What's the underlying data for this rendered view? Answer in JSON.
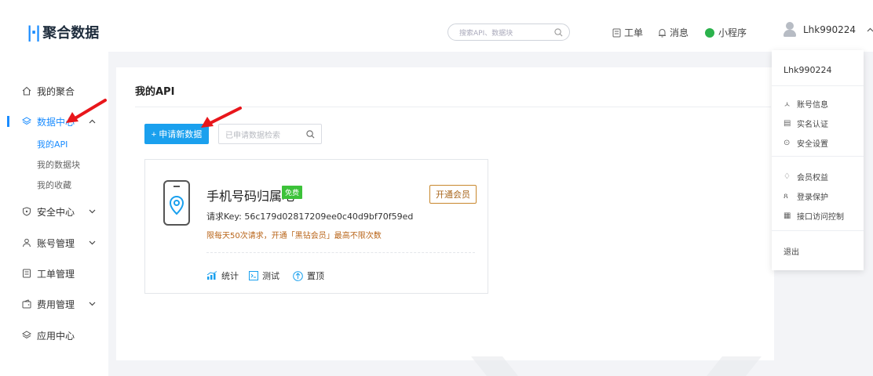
{
  "header": {
    "logo_text": "聚合数据",
    "search_placeholder": "搜索API、数据块",
    "ticket_label": "工单",
    "message_label": "消息",
    "mini_program_label": "小程序",
    "username": "Lhk990224"
  },
  "sidebar": {
    "items": [
      {
        "label": "我的聚合",
        "icon": "home-icon"
      },
      {
        "label": "数据中心",
        "icon": "layers-icon"
      },
      {
        "label": "安全中心",
        "icon": "shield-icon"
      },
      {
        "label": "账号管理",
        "icon": "user-icon"
      },
      {
        "label": "工单管理",
        "icon": "ticket-icon"
      },
      {
        "label": "费用管理",
        "icon": "wallet-icon"
      },
      {
        "label": "应用中心",
        "icon": "layers-icon"
      }
    ],
    "sub_items": [
      "我的API",
      "我的数据块",
      "我的收藏"
    ]
  },
  "main": {
    "title": "我的API",
    "apply_button": "+ 申请新数据",
    "search_placeholder": "已申请数据检索",
    "card": {
      "name": "手机号码归属地",
      "badge": "免费",
      "member_button": "开通会员",
      "request_key": "请求Key: 56c179d02817209ee0c40d9bf70f59ed",
      "limit_text": "限每天50次请求，开通「黑钻会员」最高不限次数",
      "actions": [
        "统计",
        "测试",
        "置顶"
      ]
    }
  },
  "dropdown": {
    "username": "Lhk990224",
    "items": [
      "账号信息",
      "实名认证",
      "安全设置",
      "会员权益",
      "登录保护",
      "接口访问控制",
      "退出"
    ]
  },
  "colors": {
    "accent": "#1a8cff",
    "button": "#1aa0ee",
    "free_badge": "#3cc239",
    "member": "#c8872c",
    "arrow": "#e8161b"
  }
}
